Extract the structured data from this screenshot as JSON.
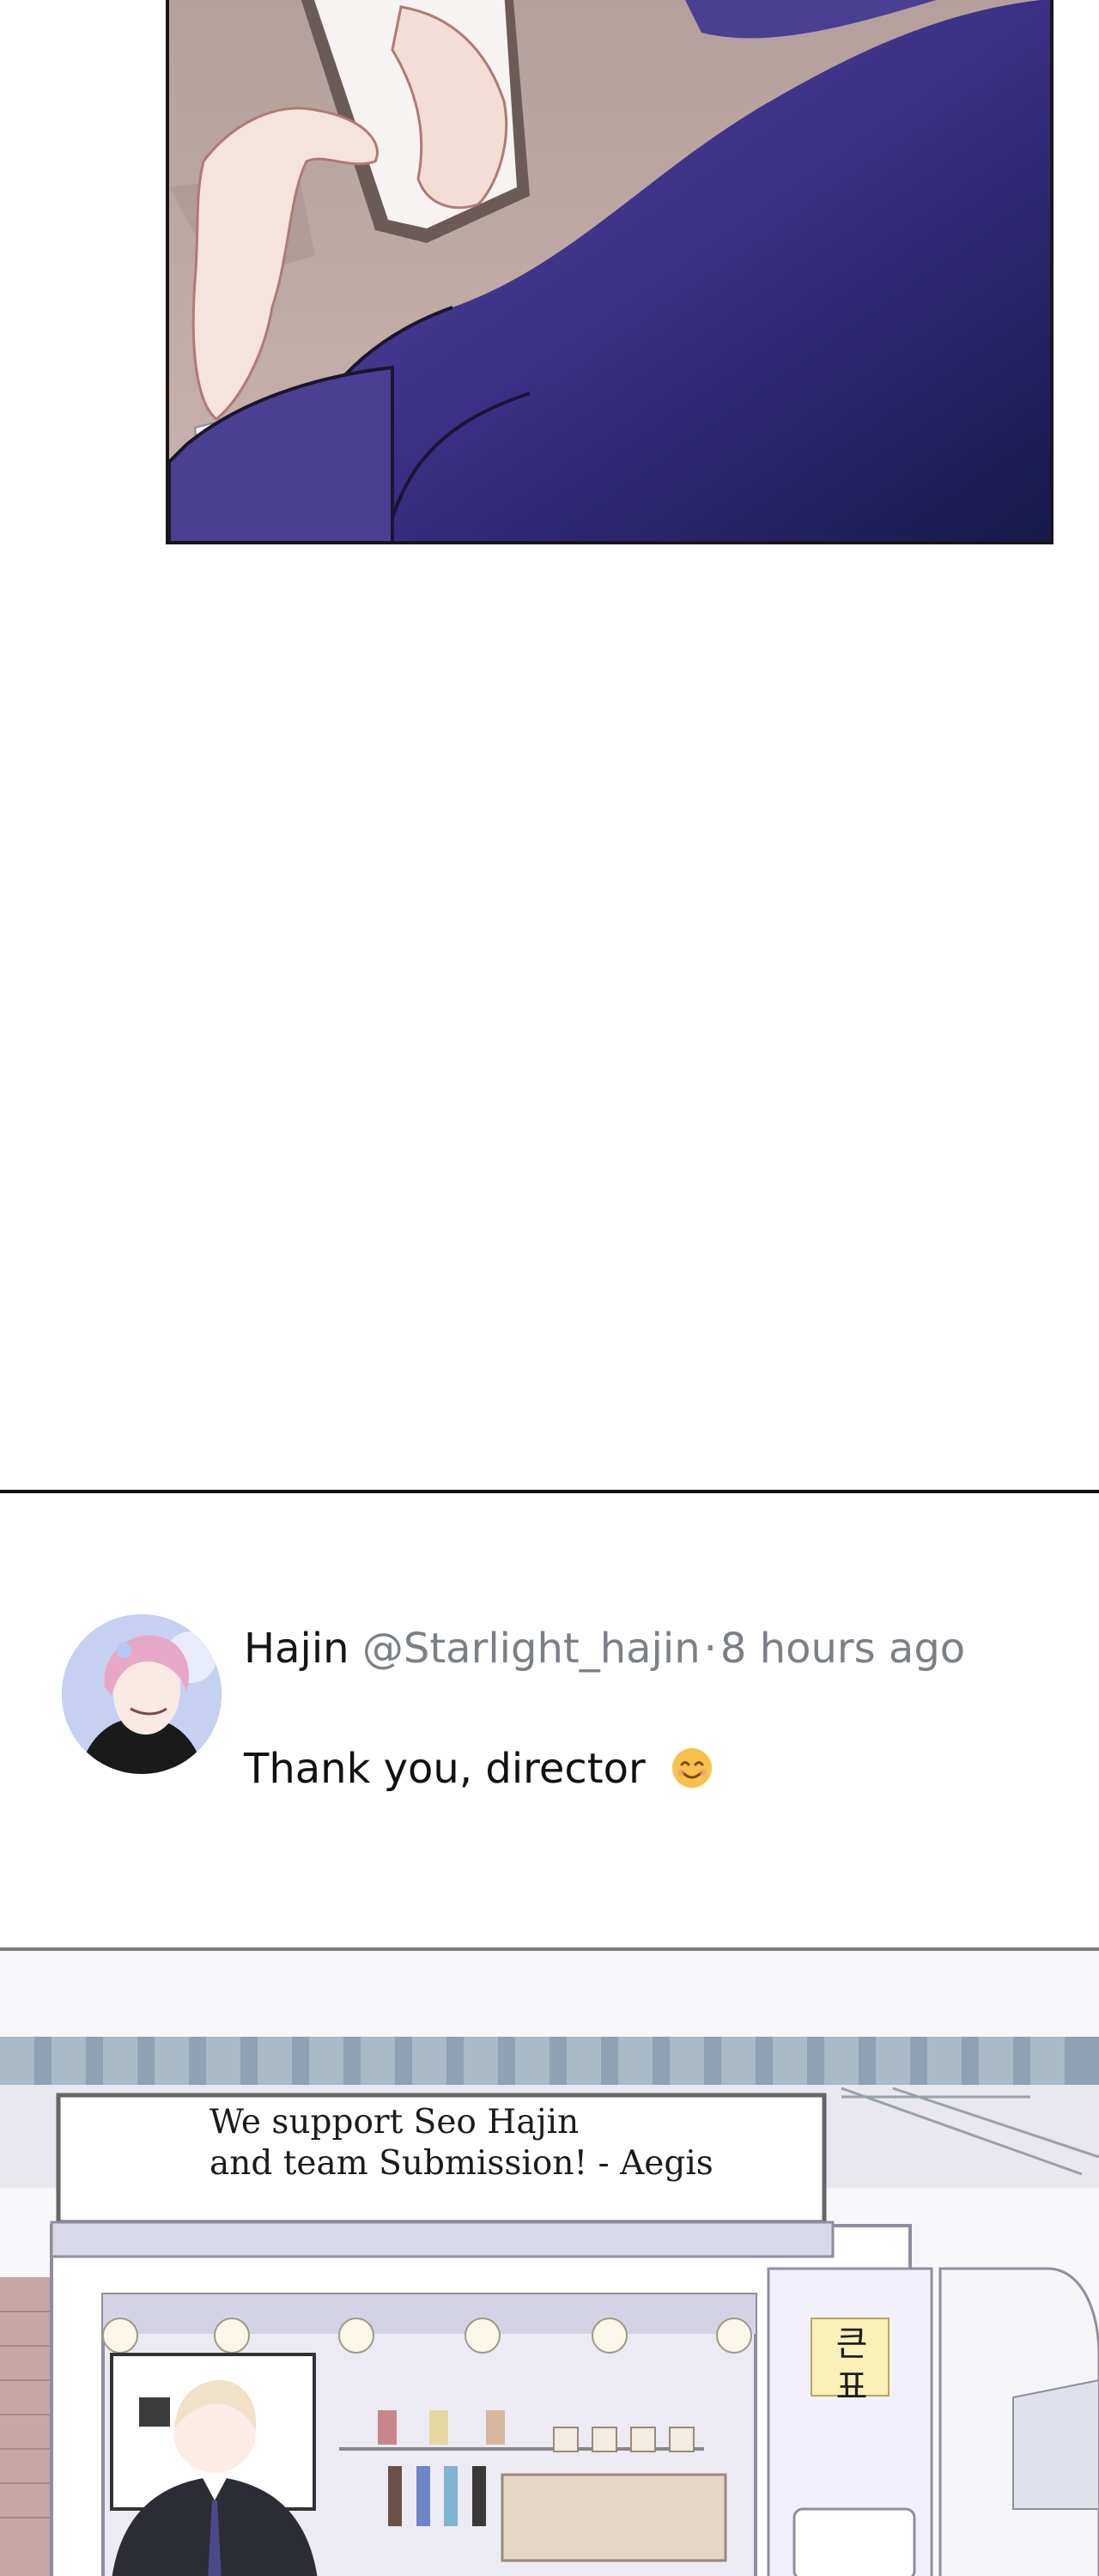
{
  "post": {
    "name": "Hajin",
    "handle": "@Starlight_hajin",
    "separator": "·",
    "time": "8 hours ago",
    "body": "Thank you, director",
    "emoji": "smiling-face-emoji"
  },
  "banner": {
    "line1": "We support Seo Hajin",
    "line2": "and team Submission! - Aegis"
  },
  "sign": {
    "text": "큰표"
  },
  "icons": {
    "avatar": "avatar-illustration",
    "emoji": "smiling-face-icon"
  },
  "colors": {
    "suit_navy": "#2b2a6e",
    "meta_gray": "#7b7f86",
    "divider": "#111111"
  }
}
